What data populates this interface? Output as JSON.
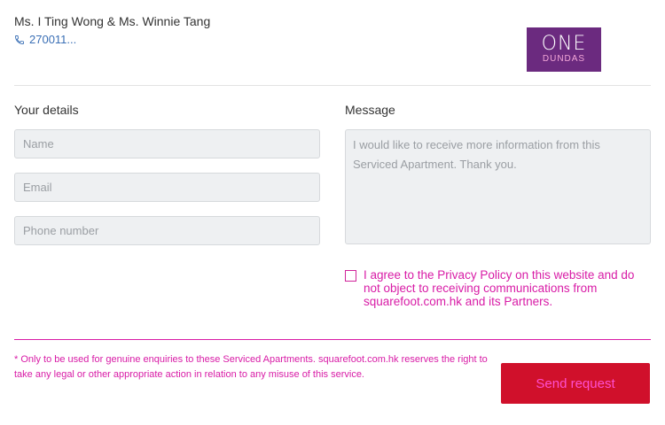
{
  "agent": {
    "name": "Ms. I Ting Wong & Ms. Winnie Tang",
    "phone": "270011...",
    "phone_icon": "phone-icon"
  },
  "logo": {
    "top": "ONE",
    "bottom": "DUNDAS"
  },
  "form": {
    "details_title": "Your details",
    "name_placeholder": "Name",
    "email_placeholder": "Email",
    "phone_placeholder": "Phone number",
    "message_title": "Message",
    "message_text": "I would like to receive more information from this Serviced Apartment. Thank you.",
    "consent_text": "I agree to the Privacy Policy on this website and do not object to receiving communications from squarefoot.com.hk and its Partners.",
    "consent_checked": false,
    "disclaimer": "* Only to be used for genuine enquiries to these Serviced Apartments. squarefoot.com.hk reserves the right to take any legal or other appropriate action in relation to any misuse of this service.",
    "send_label": "Send request"
  },
  "colors": {
    "link": "#3a6fb5",
    "logo_bg": "#6b2a7f",
    "send_bg": "#d0102b",
    "accent_text": "#d81ba6"
  }
}
